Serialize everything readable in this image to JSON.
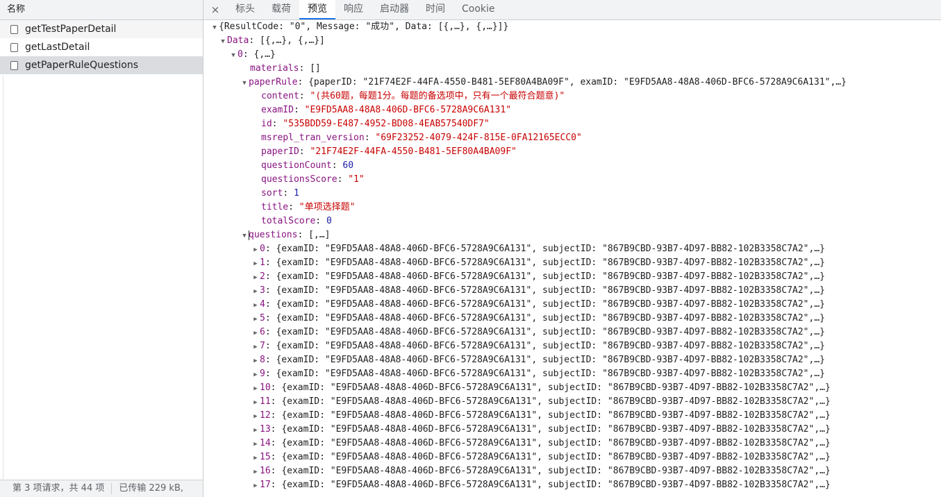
{
  "list": {
    "header": "名称",
    "requests": [
      "getTestPaperDetail",
      "getLastDetail",
      "getPaperRuleQuestions"
    ],
    "status_count": "第 3 项请求，共 44 项",
    "status_transfer": "已传输 229 kB,"
  },
  "tabs": [
    "标头",
    "载荷",
    "预览",
    "响应",
    "启动器",
    "时间",
    "Cookie"
  ],
  "close_icon": "×",
  "tree": {
    "root": "{ResultCode: \"0\", Message: \"成功\", Data: [{,…}, {,…}]}",
    "data_key": "Data",
    "data_summary": "[{,…}, {,…}]",
    "item0_key": "0",
    "item0_summary": "{,…}",
    "materials_key": "materials",
    "materials_val": "[]",
    "paperRule_key": "paperRule",
    "paperRule_summary": "{paperID: \"21F74E2F-44FA-4550-B481-5EF80A4BA09F\", examID: \"E9FD5AA8-48A8-406D-BFC6-5728A9C6A131\",…}",
    "fields": [
      {
        "key": "content",
        "value": "\"(共60题，每题1分。每题的备选项中，只有一个最符合题意)\"",
        "type": "str"
      },
      {
        "key": "examID",
        "value": "\"E9FD5AA8-48A8-406D-BFC6-5728A9C6A131\"",
        "type": "str"
      },
      {
        "key": "id",
        "value": "\"535BDD59-E487-4952-BD08-4EAB57540DF7\"",
        "type": "str"
      },
      {
        "key": "msrepl_tran_version",
        "value": "\"69F23252-4079-424F-815E-0FA12165ECC0\"",
        "type": "str"
      },
      {
        "key": "paperID",
        "value": "\"21F74E2F-44FA-4550-B481-5EF80A4BA09F\"",
        "type": "str"
      },
      {
        "key": "questionCount",
        "value": "60",
        "type": "num"
      },
      {
        "key": "questionsScore",
        "value": "\"1\"",
        "type": "str"
      },
      {
        "key": "sort",
        "value": "1",
        "type": "num"
      },
      {
        "key": "title",
        "value": "\"单项选择题\"",
        "type": "str"
      },
      {
        "key": "totalScore",
        "value": "0",
        "type": "num"
      }
    ],
    "questions_key": "questions",
    "questions_summary": "[,…]",
    "question_summary": "{examID: \"E9FD5AA8-48A8-406D-BFC6-5728A9C6A131\", subjectID: \"867B9CBD-93B7-4D97-BB82-102B3358C7A2\",…}",
    "question_indices": [
      "0",
      "1",
      "2",
      "3",
      "4",
      "5",
      "6",
      "7",
      "8",
      "9",
      "10",
      "11",
      "12",
      "13",
      "14",
      "15",
      "16",
      "17"
    ]
  }
}
